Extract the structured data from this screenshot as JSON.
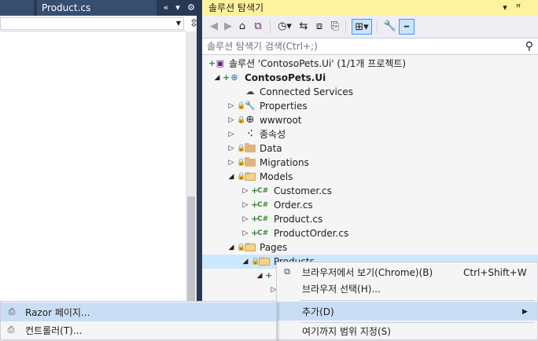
{
  "editor": {
    "tabs": [
      {
        "label": ""
      },
      {
        "label": "Product.cs"
      }
    ],
    "tabbar_buttons": [
      "«",
      "▾",
      "⚙"
    ],
    "split_glyph": "⇳"
  },
  "solution_explorer": {
    "title": "솔루션 탐색기",
    "title_buttons": [
      "▾",
      "ᵖ"
    ],
    "search": {
      "value": "",
      "placeholder": "솔루션 탐색기 검색(Ctrl+;)"
    },
    "toolbar_icons": [
      "back-icon",
      "forward-icon",
      "home-icon",
      "vs-icon",
      "history-icon",
      "sync-icon",
      "collapse-icon",
      "show-all-icon",
      "tree-view-icon",
      "wrench-icon",
      "preview-icon"
    ],
    "tree": [
      {
        "label": "솔루션 'ContosoPets.Ui' (1/1개 프로젝트)"
      },
      {
        "label": "ContosoPets.Ui"
      },
      {
        "label": "Connected Services"
      },
      {
        "label": "Properties"
      },
      {
        "label": "wwwroot"
      },
      {
        "label": "종속성"
      },
      {
        "label": "Data"
      },
      {
        "label": "Migrations"
      },
      {
        "label": "Models"
      },
      {
        "label": "Customer.cs"
      },
      {
        "label": "Order.cs"
      },
      {
        "label": "Product.cs"
      },
      {
        "label": "ProductOrder.cs"
      },
      {
        "label": "Pages"
      },
      {
        "label": "Products"
      }
    ]
  },
  "context_menu": {
    "items": [
      {
        "label": "브라우저에서 보기(Chrome)(B)",
        "shortcut": "Ctrl+Shift+W",
        "icon": "browser-view-icon"
      },
      {
        "label": "브라우저 선택(H)..."
      },
      {
        "label": "추가(D)",
        "submenu_glyph": "▶"
      },
      {
        "label": "여기까지 범위 지정(S)"
      }
    ]
  },
  "submenu": {
    "items": [
      {
        "label": "Razor 페이지...",
        "icon": "razor-page-icon"
      },
      {
        "label": "컨트롤러(T)...",
        "icon": "controller-icon"
      }
    ]
  },
  "colors": {
    "title_active": "#fff29d",
    "tab_bar": "#293955",
    "selection": "#cce8ff",
    "menu_highlight": "#c9def5",
    "csharp": "#388a34",
    "folder": "#dcb67a"
  }
}
